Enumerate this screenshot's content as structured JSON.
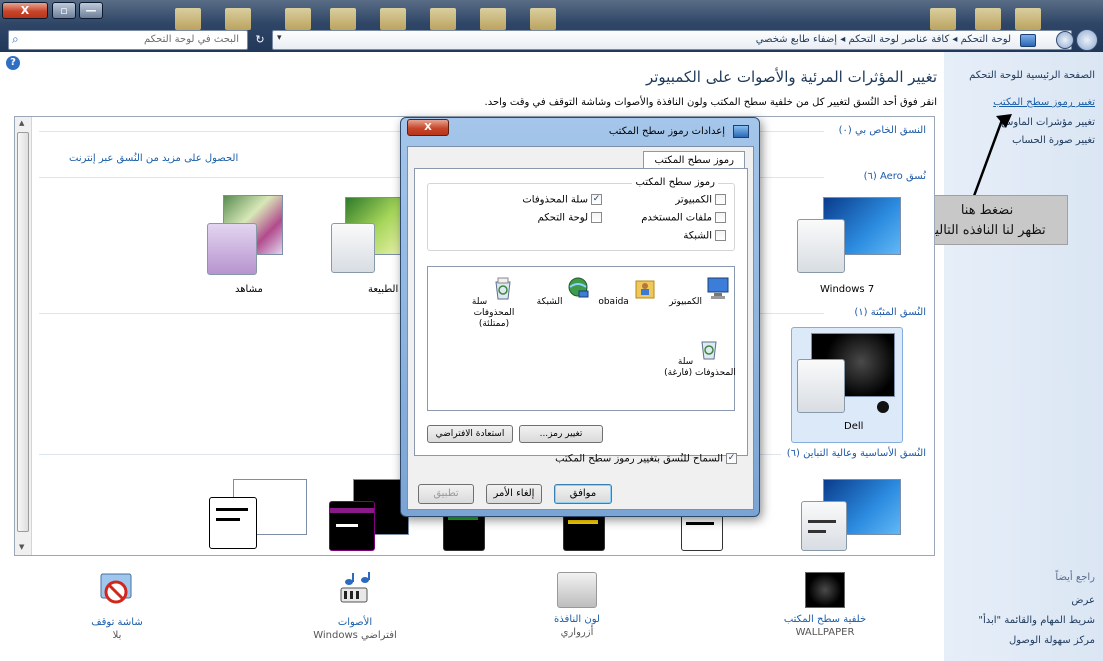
{
  "window": {
    "close_glyph": "X",
    "max_glyph": "▫",
    "min_glyph": "—"
  },
  "addressbar": {
    "path": "لوحة التحكم ◂ كافة عناصر لوحة التحكم ◂ إضفاء طابع شخصي",
    "search_placeholder": "البحث في لوحة التحكم",
    "search_icon": "⌕",
    "refresh_glyph": "↻",
    "dropdown_glyph": "▾"
  },
  "help_glyph": "?",
  "nav": {
    "home": "الصفحة الرئيسية للوحة التحكم",
    "desktop_icons": "تغيير رموز سطح المكتب",
    "mouse_pointers": "تغيير مؤشرات الماوس",
    "account_picture": "تغيير صورة الحساب",
    "see_also": "راجع أيضاً",
    "display": "عرض",
    "taskbar": "شريط المهام والقائمة \"ابدأ\"",
    "ease_access": "مركز سهولة الوصول"
  },
  "annotation": {
    "line1": "نضغط هنا",
    "line2": "تظهر لنا النافذه التالية"
  },
  "page": {
    "title": "تغيير المؤثرات المرئية والأصوات على الكمبيوتر",
    "description": "انقر فوق أحد النُسق لتغيير كل من خلفية سطح المكتب ولون النافذة والأصوات وشاشة التوقف في وقت واحد."
  },
  "themes": {
    "my_themes_header": "النسق الخاص بي (٠)",
    "get_more": "الحصول على مزيد من النُسق عبر إنترنت",
    "aero_header": "نُسق Aero (٦)",
    "installed_header": "النُسق المثبّتة (١)",
    "basic_header": "النُسق الأساسية وعالية التباين (٦)",
    "aero_items": [
      "Windows 7",
      "الطبيعة",
      "مشاهد"
    ],
    "installed_items": [
      "Dell"
    ],
    "scroll_up": "▲",
    "scroll_down": "▼"
  },
  "bottom": [
    {
      "title": "خلفية سطح المكتب",
      "sub": "WALLPAPER"
    },
    {
      "title": "لون النافذة",
      "sub": "أزرواري"
    },
    {
      "title": "الأصوات",
      "sub": "افتراضي Windows"
    },
    {
      "title": "شاشة توقف",
      "sub": "بلا"
    }
  ],
  "dialog": {
    "title": "إعدادات رموز سطح المكتب",
    "close_glyph": "X",
    "tab": "رموز سطح المكتب",
    "group_title": "رموز سطح المكتب",
    "checkboxes": {
      "computer": "الكمبيوتر",
      "recycle_bin": "سلة المحذوفات",
      "user_files": "ملفات المستخدم",
      "control_panel": "لوحة التحكم",
      "network": "الشبكة"
    },
    "checked": {
      "computer": false,
      "recycle_bin": true,
      "user_files": false,
      "control_panel": false,
      "network": false,
      "allow_themes": true
    },
    "check_glyph": "✓",
    "icons": {
      "computer": "الكمبيوتر",
      "user": "obaida",
      "network": "الشبكة",
      "bin_full": "سلة المحذوفات (ممتلئة)",
      "bin_empty": "سلة المحذوفات (فارغة)"
    },
    "change_icon": "تغيير رمز...",
    "restore_default": "استعادة الافتراضي",
    "allow_themes": "السماح للنُسق بتغيير رموز سطح المكتب",
    "ok": "موافق",
    "cancel": "إلغاء الأمر",
    "apply": "تطبيق"
  }
}
